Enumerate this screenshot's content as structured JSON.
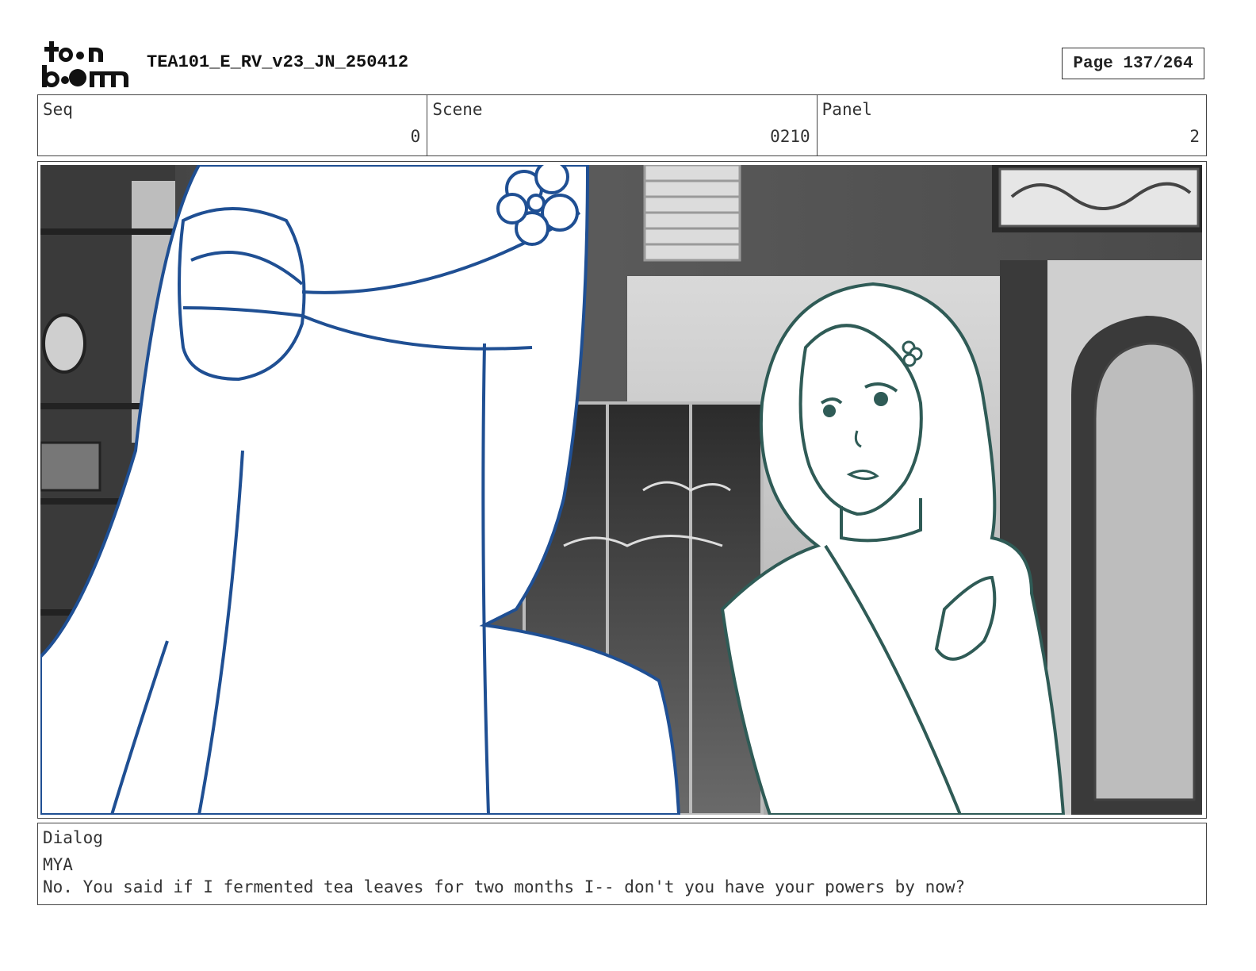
{
  "header": {
    "logo_text": "toonboom",
    "title": "TEA101_E_RV_v23_JN_250412",
    "page_label": "Page 137/264"
  },
  "meta": {
    "seq": {
      "label": "Seq",
      "value": "0"
    },
    "scene": {
      "label": "Scene",
      "value": "0210"
    },
    "panel": {
      "label": "Panel",
      "value": "2"
    }
  },
  "panel_image": {
    "description_icon": "storyboard-panel-image",
    "colors": {
      "left_character": "#1f4f93",
      "right_character": "#2f5b56",
      "background": "#8a8a8a"
    }
  },
  "dialog": {
    "label": "Dialog",
    "speaker": "MYA",
    "line": "No. You said if I fermented tea leaves for two months I-- don't you have your powers by now?"
  }
}
